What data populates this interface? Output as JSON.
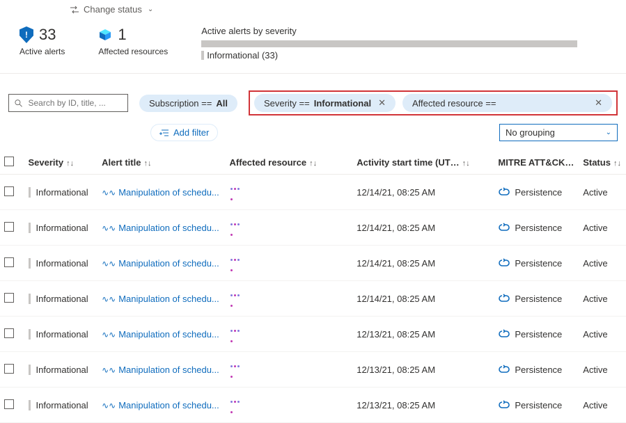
{
  "topAction": {
    "label": "Change status"
  },
  "stats": {
    "activeAlerts": {
      "count": "33",
      "label": "Active alerts"
    },
    "affectedResources": {
      "count": "1",
      "label": "Affected resources"
    },
    "severity": {
      "title": "Active alerts by severity",
      "legend": "Informational (33)"
    }
  },
  "search": {
    "placeholder": "Search by ID, title, ..."
  },
  "filters": {
    "subscription": {
      "label": "Subscription == ",
      "value": "All"
    },
    "severity": {
      "label": "Severity == ",
      "value": "Informational"
    },
    "resource": {
      "label": "Affected resource ==",
      "value": ""
    },
    "addFilter": "Add filter"
  },
  "grouping": {
    "value": "No grouping"
  },
  "columns": {
    "severity": "Severity",
    "title": "Alert title",
    "resource": "Affected resource",
    "time": "Activity start time (UT…",
    "mitre": "MITRE ATT&CK…",
    "status": "Status"
  },
  "rows": [
    {
      "severity": "Informational",
      "title": "Manipulation of schedu...",
      "time": "12/14/21, 08:25 AM",
      "mitre": "Persistence",
      "status": "Active"
    },
    {
      "severity": "Informational",
      "title": "Manipulation of schedu...",
      "time": "12/14/21, 08:25 AM",
      "mitre": "Persistence",
      "status": "Active"
    },
    {
      "severity": "Informational",
      "title": "Manipulation of schedu...",
      "time": "12/14/21, 08:25 AM",
      "mitre": "Persistence",
      "status": "Active"
    },
    {
      "severity": "Informational",
      "title": "Manipulation of schedu...",
      "time": "12/14/21, 08:25 AM",
      "mitre": "Persistence",
      "status": "Active"
    },
    {
      "severity": "Informational",
      "title": "Manipulation of schedu...",
      "time": "12/13/21, 08:25 AM",
      "mitre": "Persistence",
      "status": "Active"
    },
    {
      "severity": "Informational",
      "title": "Manipulation of schedu...",
      "time": "12/13/21, 08:25 AM",
      "mitre": "Persistence",
      "status": "Active"
    },
    {
      "severity": "Informational",
      "title": "Manipulation of schedu...",
      "time": "12/13/21, 08:25 AM",
      "mitre": "Persistence",
      "status": "Active"
    }
  ]
}
